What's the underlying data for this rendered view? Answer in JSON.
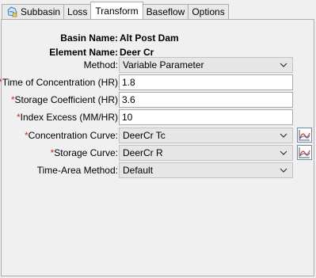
{
  "tabs": [
    {
      "label": "Subbasin",
      "icon": "subbasin-icon",
      "active": false
    },
    {
      "label": "Loss",
      "active": false
    },
    {
      "label": "Transform",
      "active": true
    },
    {
      "label": "Baseflow",
      "active": false
    },
    {
      "label": "Options",
      "active": false
    }
  ],
  "form": {
    "basin_name_label": "Basin Name:",
    "basin_name_value": "Alt Post Dam",
    "element_name_label": "Element Name:",
    "element_name_value": "Deer Cr",
    "method_label": "Method:",
    "method_value": "Variable Parameter",
    "required_marker": "*",
    "toc_label": "Time of Concentration (HR)",
    "toc_value": "1.8",
    "storage_coef_label": "Storage Coefficient (HR)",
    "storage_coef_value": "3.6",
    "index_excess_label": "Index Excess (MM/HR)",
    "index_excess_value": "10",
    "conc_curve_label": "Concentration Curve:",
    "conc_curve_value": "DeerCr Tc",
    "storage_curve_label": "Storage Curve:",
    "storage_curve_value": "DeerCr R",
    "time_area_label": "Time-Area Method:",
    "time_area_value": "Default"
  },
  "colors": {
    "required": "#e0241b",
    "graph_line_red": "#d9432c",
    "graph_line_blue": "#3a6fb4"
  },
  "icons": {
    "dropdown": "chevron-down-icon",
    "graph": "graph-icon"
  }
}
